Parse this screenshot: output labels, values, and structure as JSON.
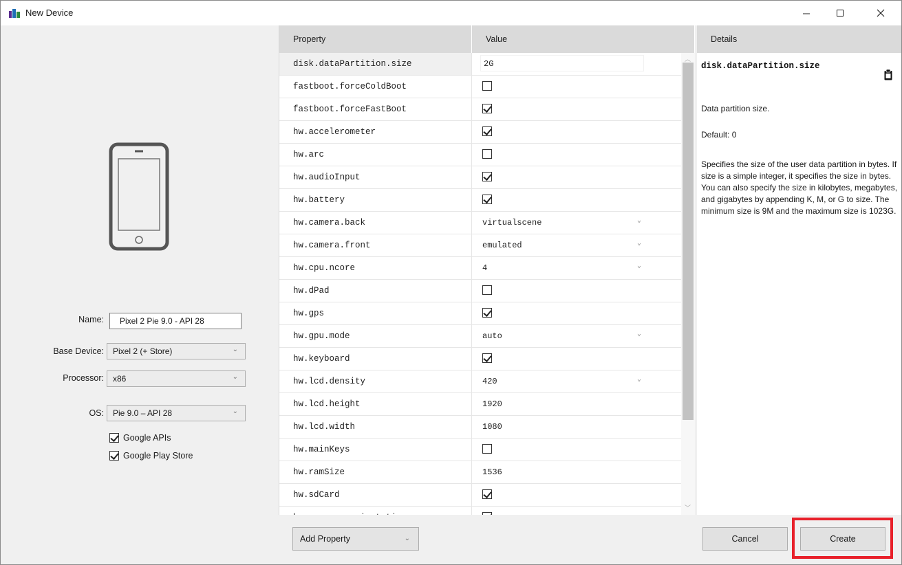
{
  "window": {
    "title": "New Device",
    "controls": {
      "minimize": "—",
      "maximize": "☐",
      "close": "✕"
    }
  },
  "form": {
    "name_label": "Name:",
    "name_value": "Pixel 2 Pie 9.0 - API 28",
    "base_device_label": "Base Device:",
    "base_device_value": "Pixel 2 (+ Store)",
    "processor_label": "Processor:",
    "processor_value": "x86",
    "os_label": "OS:",
    "os_value": "Pie 9.0 – API 28",
    "google_apis_label": "Google APIs",
    "google_apis_checked": true,
    "google_play_label": "Google Play Store",
    "google_play_checked": true
  },
  "grid": {
    "col_property": "Property",
    "col_value": "Value",
    "rows": [
      {
        "property": "disk.dataPartition.size",
        "type": "text",
        "value": "2G",
        "selected": true
      },
      {
        "property": "fastboot.forceColdBoot",
        "type": "check",
        "checked": false
      },
      {
        "property": "fastboot.forceFastBoot",
        "type": "check",
        "checked": true
      },
      {
        "property": "hw.accelerometer",
        "type": "check",
        "checked": true
      },
      {
        "property": "hw.arc",
        "type": "check",
        "checked": false
      },
      {
        "property": "hw.audioInput",
        "type": "check",
        "checked": true
      },
      {
        "property": "hw.battery",
        "type": "check",
        "checked": true
      },
      {
        "property": "hw.camera.back",
        "type": "select",
        "value": "virtualscene"
      },
      {
        "property": "hw.camera.front",
        "type": "select",
        "value": "emulated"
      },
      {
        "property": "hw.cpu.ncore",
        "type": "select",
        "value": "4"
      },
      {
        "property": "hw.dPad",
        "type": "check",
        "checked": false
      },
      {
        "property": "hw.gps",
        "type": "check",
        "checked": true
      },
      {
        "property": "hw.gpu.mode",
        "type": "select",
        "value": "auto"
      },
      {
        "property": "hw.keyboard",
        "type": "check",
        "checked": true
      },
      {
        "property": "hw.lcd.density",
        "type": "select",
        "value": "420"
      },
      {
        "property": "hw.lcd.height",
        "type": "plain",
        "value": "1920"
      },
      {
        "property": "hw.lcd.width",
        "type": "plain",
        "value": "1080"
      },
      {
        "property": "hw.mainKeys",
        "type": "check",
        "checked": false
      },
      {
        "property": "hw.ramSize",
        "type": "plain",
        "value": "1536"
      },
      {
        "property": "hw.sdCard",
        "type": "check",
        "checked": true
      },
      {
        "property": "hw.sensors.orientation",
        "type": "check",
        "checked": true
      }
    ],
    "add_property_label": "Add Property"
  },
  "details": {
    "header": "Details",
    "title": "disk.dataPartition.size",
    "short": "Data partition size.",
    "default": "Default: 0",
    "long": "Specifies the size of the user data partition in bytes. If size is a simple integer, it specifies the size in bytes. You can also specify the size in kilobytes, megabytes, and gigabytes by appending K, M, or G to size. The minimum size is 9M and the maximum size is 1023G."
  },
  "buttons": {
    "cancel": "Cancel",
    "create": "Create"
  },
  "colors": {
    "highlight": "#e8202a",
    "header_bg": "#dadada",
    "window_bg": "#f0f0f0"
  }
}
